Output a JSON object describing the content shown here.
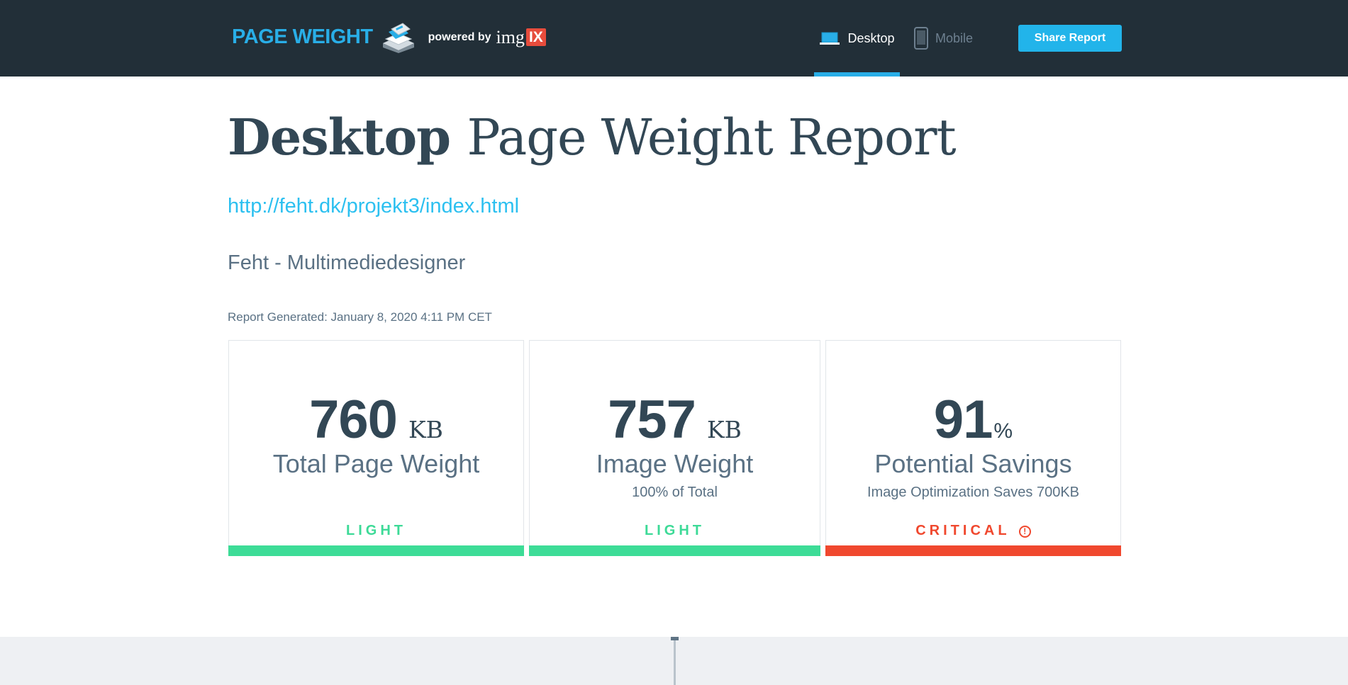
{
  "header": {
    "brand_text": "PAGE WEIGHT",
    "powered_by": "powered by",
    "imgix_text": "img",
    "imgix_badge": "IX",
    "tabs": [
      {
        "label": "Desktop",
        "active": true,
        "icon": "laptop-icon"
      },
      {
        "label": "Mobile",
        "active": false,
        "icon": "phone-icon"
      }
    ],
    "share_label": "Share Report"
  },
  "report": {
    "title_bold": "Desktop",
    "title_rest": "Page Weight Report",
    "url": "http://feht.dk/projekt3/index.html",
    "site_title": "Feht - Multimediedesigner",
    "generated": "Report Generated: January 8, 2020 4:11 PM CET"
  },
  "cards": [
    {
      "value": "760",
      "unit": "KB",
      "label": "Total Page Weight",
      "sub": "",
      "status": "LIGHT",
      "status_color": "#3ddc97"
    },
    {
      "value": "757",
      "unit": "KB",
      "label": "Image Weight",
      "sub": "100% of Total",
      "status": "LIGHT",
      "status_color": "#3ddc97"
    },
    {
      "value": "91",
      "unit": "%",
      "label": "Potential Savings",
      "sub": "Image Optimization Saves 700KB",
      "status": "CRITICAL",
      "status_color": "#f0482e",
      "status_icon": "warning-icon"
    }
  ],
  "colors": {
    "header_bg": "#222f38",
    "accent": "#29aee7",
    "light": "#3ddc97",
    "critical": "#f0482e"
  }
}
